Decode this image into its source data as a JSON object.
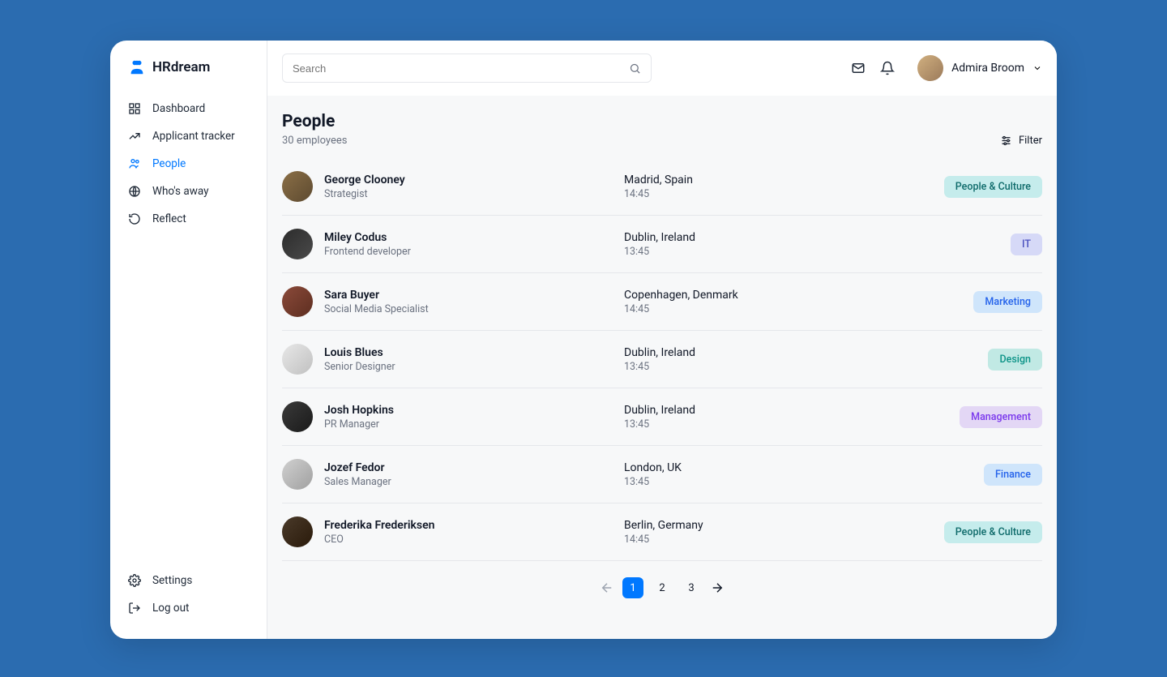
{
  "brand": "HRdream",
  "sidebar": {
    "items": [
      {
        "label": "Dashboard"
      },
      {
        "label": "Applicant tracker"
      },
      {
        "label": "People"
      },
      {
        "label": "Who's away"
      },
      {
        "label": "Reflect"
      }
    ],
    "bottom": [
      {
        "label": "Settings"
      },
      {
        "label": "Log out"
      }
    ]
  },
  "topbar": {
    "search_placeholder": "Search",
    "user_name": "Admira Broom"
  },
  "page": {
    "title": "People",
    "count_label": "30 employees",
    "filter_label": "Filter"
  },
  "employees": [
    {
      "name": "George Clooney",
      "role": "Strategist",
      "location": "Madrid, Spain",
      "time": "14:45",
      "tag": "People & Culture",
      "tag_class": "tag-people",
      "av": "av1"
    },
    {
      "name": "Miley Codus",
      "role": "Frontend developer",
      "location": "Dublin, Ireland",
      "time": "13:45",
      "tag": "IT",
      "tag_class": "tag-it",
      "av": "av2"
    },
    {
      "name": "Sara Buyer",
      "role": "Social Media Specialist",
      "location": "Copenhagen, Denmark",
      "time": "14:45",
      "tag": "Marketing",
      "tag_class": "tag-marketing",
      "av": "av3"
    },
    {
      "name": "Louis Blues",
      "role": "Senior Designer",
      "location": "Dublin, Ireland",
      "time": "13:45",
      "tag": "Design",
      "tag_class": "tag-design",
      "av": "av4"
    },
    {
      "name": "Josh Hopkins",
      "role": "PR Manager",
      "location": "Dublin, Ireland",
      "time": "13:45",
      "tag": "Management",
      "tag_class": "tag-management",
      "av": "av5"
    },
    {
      "name": "Jozef Fedor",
      "role": "Sales Manager",
      "location": "London, UK",
      "time": "13:45",
      "tag": "Finance",
      "tag_class": "tag-finance",
      "av": "av6"
    },
    {
      "name": "Frederika Frederiksen",
      "role": "CEO",
      "location": "Berlin, Germany",
      "time": "14:45",
      "tag": "People & Culture",
      "tag_class": "tag-people",
      "av": "av7"
    }
  ],
  "pagination": {
    "pages": [
      "1",
      "2",
      "3"
    ],
    "active": "1"
  }
}
